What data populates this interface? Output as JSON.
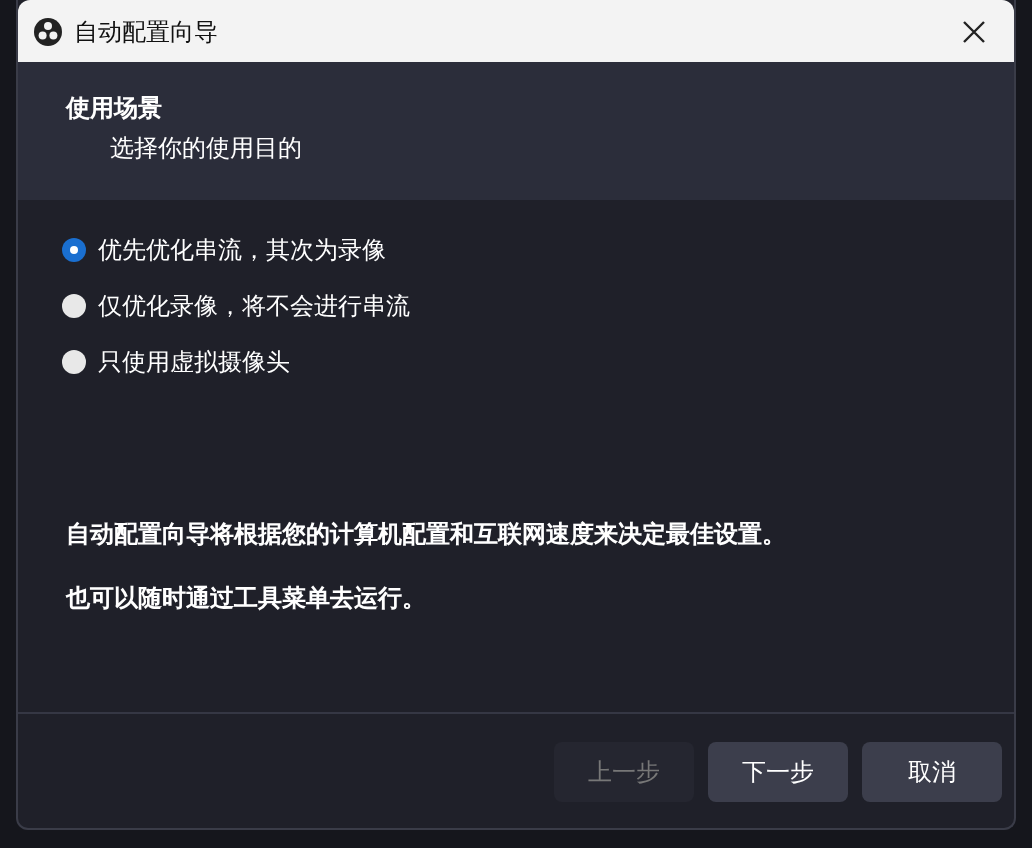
{
  "window": {
    "title": "自动配置向导"
  },
  "header": {
    "title": "使用场景",
    "subtitle": "选择你的使用目的"
  },
  "options": [
    {
      "label": "优先优化串流，其次为录像",
      "selected": true
    },
    {
      "label": "仅优化录像，将不会进行串流",
      "selected": false
    },
    {
      "label": "只使用虚拟摄像头",
      "selected": false
    }
  ],
  "notes": [
    "自动配置向导将根据您的计算机配置和互联网速度来决定最佳设置。",
    "也可以随时通过工具菜单去运行。"
  ],
  "buttons": [
    {
      "label": "上一步",
      "disabled": true
    },
    {
      "label": "下一步",
      "disabled": false
    },
    {
      "label": "取消",
      "disabled": false
    }
  ]
}
